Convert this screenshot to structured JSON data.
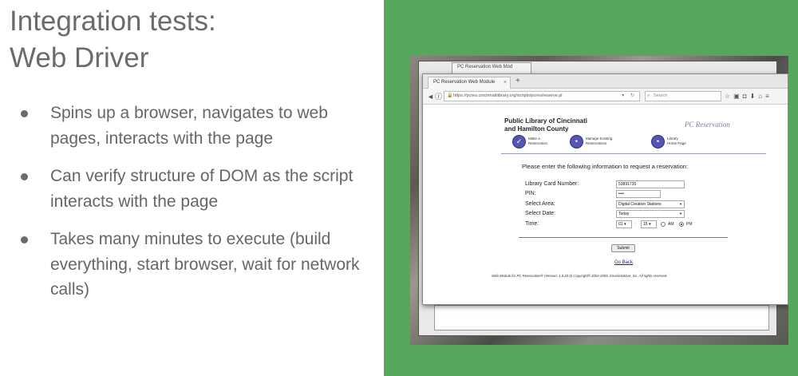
{
  "slide": {
    "title_line1": "Integration tests:",
    "title_line2": "Web Driver",
    "bullets": [
      "Spins up a browser, navigates to web pages, interacts with the page",
      "Can verify structure of DOM as the script interacts with the page",
      "Takes many minutes to execute (build everything, start browser, wait for network calls)"
    ]
  },
  "colors": {
    "panel_green": "#58a65c",
    "text_gray": "#666666"
  },
  "browser": {
    "back_tab_label": "PC Reservation Web Mod",
    "tab_label": "PC Reservation Web Module",
    "tab_close": "×",
    "new_tab": "+",
    "url": "https://pcres.cincinnatilibrary.org/scripts/pcres/reserve.pl",
    "search_placeholder": "Search",
    "icons": [
      "star-icon",
      "clipboard-icon",
      "pocket-icon",
      "download-icon",
      "home-icon",
      "menu-icon"
    ]
  },
  "page": {
    "library_line1": "Public Library of Cincinnati",
    "library_line2": "and Hamilton County",
    "logo_text": "PC Reservation",
    "steps": [
      {
        "line1": "Make a",
        "line2": "Reservation"
      },
      {
        "line1": "Manage Existing",
        "line2": "Reservations"
      },
      {
        "line1": "Library",
        "line2": "Home Page"
      }
    ],
    "instructions": "Please enter the following information to request a reservation:",
    "fields": {
      "card_label": "Library Card Number:",
      "card_value": "53891735",
      "pin_label": "PIN:",
      "pin_value": "••••",
      "area_label": "Select Area:",
      "area_value": "Digital Creation Stations",
      "date_label": "Select Date:",
      "date_value": "Today",
      "time_label": "Time:",
      "time_hour": "01",
      "time_minute": "15",
      "time_sep": ":",
      "am_label": "AM",
      "pm_label": "PM",
      "selected_period": "PM"
    },
    "submit_label": "Submit",
    "goback_label": "Go Back",
    "footer": "Web Module for PC Reservation® (Version: 1.0.20.0) Copyright® 2002-2009, EnvisionWare, Inc. All rights reserved."
  }
}
